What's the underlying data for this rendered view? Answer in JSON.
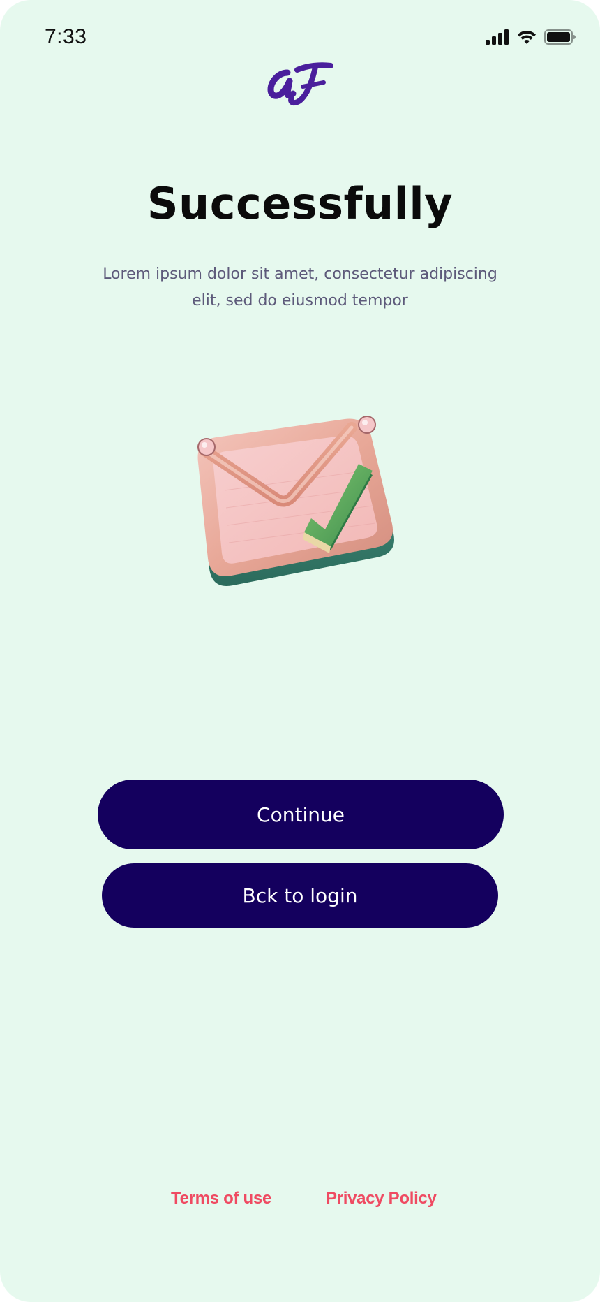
{
  "status_bar": {
    "time": "7:33",
    "icons": [
      "signal-icon",
      "wifi-icon",
      "battery-icon"
    ]
  },
  "logo": {
    "text": "aJ",
    "color": "#4a1f9c"
  },
  "content": {
    "title": "Successfully",
    "subtitle": "Lorem ipsum dolor sit amet, consectetur adipiscing elit, sed do eiusmod tempor"
  },
  "illustration": {
    "icon": "mail-check-icon"
  },
  "actions": {
    "continue_label": "Continue",
    "back_label": "Bck to login"
  },
  "footer": {
    "terms_label": "Terms of use",
    "privacy_label": "Privacy Policy"
  },
  "colors": {
    "background": "#e6f9ee",
    "button": "#14005e",
    "link": "#ef4b62",
    "title": "#0b0b0b",
    "subtitle": "#5d5a7a"
  }
}
